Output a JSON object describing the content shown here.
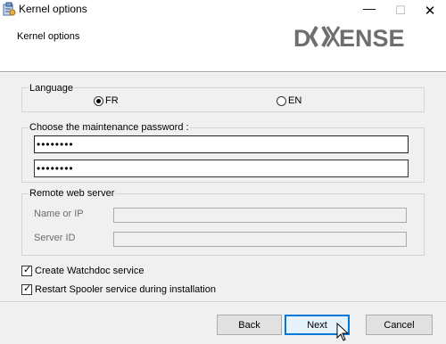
{
  "window": {
    "title": "Kernel options",
    "subtitle": "Kernel options",
    "minimize_glyph": "—",
    "maximize_glyph": "☐",
    "close_glyph": "✕"
  },
  "logo": {
    "text": "DOXENSE",
    "color": "#6d6e70"
  },
  "language": {
    "label": "Language",
    "options": [
      {
        "label": "FR",
        "selected": true
      },
      {
        "label": "EN",
        "selected": false
      }
    ]
  },
  "password": {
    "label": "Choose the maintenance password :",
    "value": "••••••••",
    "confirm_value": "••••••••"
  },
  "remote": {
    "label": "Remote web server",
    "name_label": "Name or IP",
    "id_label": "Server ID"
  },
  "options": {
    "create_service": "Create Watchdoc service",
    "restart_spooler": "Restart Spooler service during installation"
  },
  "buttons": {
    "back": "Back",
    "next": "Next",
    "cancel": "Cancel"
  }
}
